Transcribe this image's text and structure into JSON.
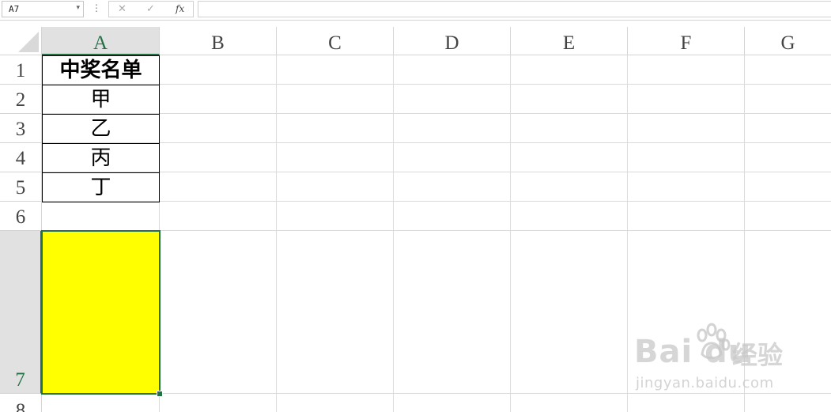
{
  "formula_bar": {
    "name_box": "A7",
    "name_box_arrow": "▾",
    "separator": "⋮",
    "cancel_glyph": "✕",
    "enter_glyph": "✓",
    "fx_label": "fx",
    "formula": ""
  },
  "columns": [
    "A",
    "B",
    "C",
    "D",
    "E",
    "F",
    "G"
  ],
  "rows": [
    "1",
    "2",
    "3",
    "4",
    "5",
    "6",
    "7",
    "8"
  ],
  "selected_cell": "A7",
  "selected_fill_color": "#ffff00",
  "selection_color": "#217346",
  "cells": {
    "A1": "中奖名单",
    "A2": "甲",
    "A3": "乙",
    "A4": "丙",
    "A5": "丁"
  },
  "watermark": {
    "logo": "Bai  du",
    "logo_suffix": "经验",
    "url": "jingyan.baidu.com"
  }
}
